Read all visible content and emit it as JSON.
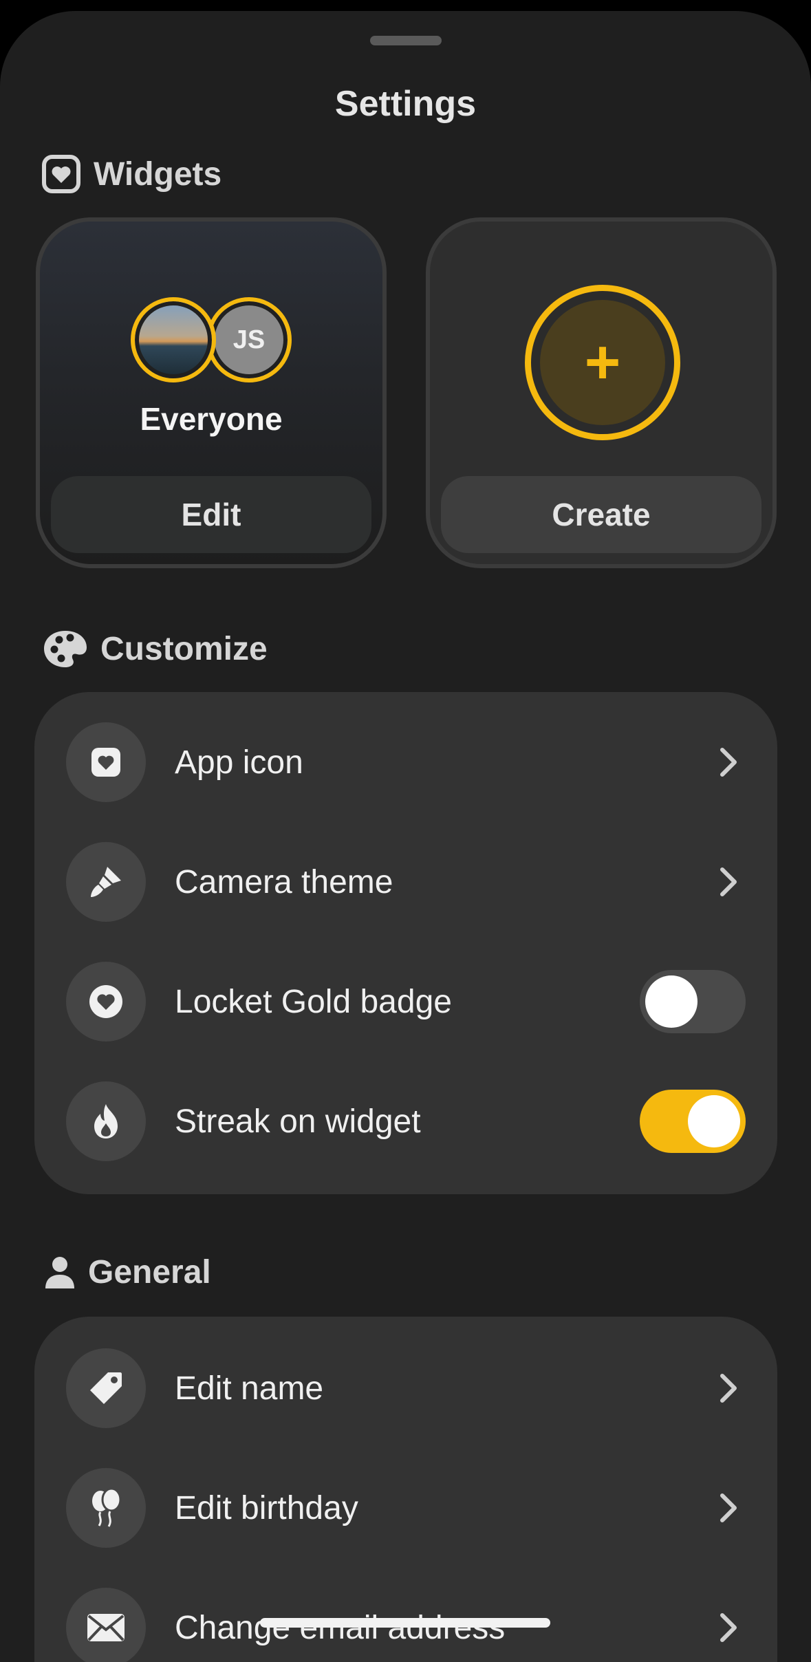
{
  "sheet": {
    "title": "Settings"
  },
  "widgets": {
    "heading": "Widgets",
    "existing": {
      "avatar_initials": "JS",
      "name": "Everyone",
      "button_label": "Edit"
    },
    "create": {
      "plus_symbol": "+",
      "button_label": "Create"
    }
  },
  "customize": {
    "heading": "Customize",
    "items": [
      {
        "label": "App icon",
        "icon": "heart-square-icon",
        "control": "chevron"
      },
      {
        "label": "Camera theme",
        "icon": "paintbrush-icon",
        "control": "chevron"
      },
      {
        "label": "Locket Gold badge",
        "icon": "heart-circle-icon",
        "control": "toggle",
        "on": false
      },
      {
        "label": "Streak on widget",
        "icon": "flame-icon",
        "control": "toggle",
        "on": true
      }
    ]
  },
  "general": {
    "heading": "General",
    "items": [
      {
        "label": "Edit name",
        "icon": "tag-icon",
        "control": "chevron"
      },
      {
        "label": "Edit birthday",
        "icon": "balloons-icon",
        "control": "chevron"
      },
      {
        "label": "Change email address",
        "icon": "envelope-icon",
        "control": "chevron"
      }
    ]
  },
  "colors": {
    "accent": "#f5b90f",
    "background": "#1f1f1f",
    "card": "#333333"
  }
}
